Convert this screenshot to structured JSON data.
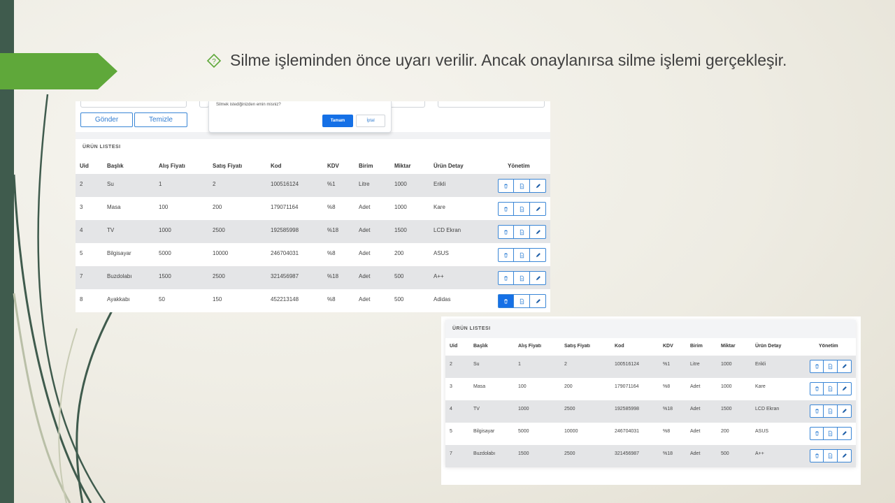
{
  "slide": {
    "bullet_text": "Silme işleminden önce uyarı verilir. Ancak onaylanırsa silme işlemi gerçekleşir."
  },
  "colors": {
    "accent_green": "#5fa83a",
    "dark_strip": "#3f5b4d",
    "primary_blue": "#1570e6",
    "row_gray": "#e4e5e7"
  },
  "form": {
    "send_label": "Gönder",
    "clear_label": "Temizle"
  },
  "dialog": {
    "message": "Silmek istediğinizden emin misniz?",
    "ok_label": "Tamam",
    "cancel_label": "İptal"
  },
  "table": {
    "title": "ÜRÜN LISTESI",
    "columns": [
      "Uid",
      "Başlık",
      "Alış Fiyatı",
      "Satış Fiyatı",
      "Kod",
      "KDV",
      "Birim",
      "Miktar",
      "Ürün Detay",
      "Yönetim"
    ],
    "rows": [
      [
        "2",
        "Su",
        "1",
        "2",
        "100516124",
        "%1",
        "Litre",
        "1000",
        "Erikli"
      ],
      [
        "3",
        "Masa",
        "100",
        "200",
        "179071164",
        "%8",
        "Adet",
        "1000",
        "Kare"
      ],
      [
        "4",
        "TV",
        "1000",
        "2500",
        "192585998",
        "%18",
        "Adet",
        "1500",
        "LCD Ekran"
      ],
      [
        "5",
        "Bilgisayar",
        "5000",
        "10000",
        "246704031",
        "%8",
        "Adet",
        "200",
        "ASUS"
      ],
      [
        "7",
        "Buzdolabı",
        "1500",
        "2500",
        "321456987",
        "%18",
        "Adet",
        "500",
        "A++"
      ],
      [
        "8",
        "Ayakkabı",
        "50",
        "150",
        "452213148",
        "%8",
        "Adet",
        "500",
        "Adidas"
      ]
    ]
  },
  "table2": {
    "title": "ÜRÜN LISTESI",
    "columns": [
      "Uid",
      "Başlık",
      "Alış Fiyatı",
      "Satış Fiyatı",
      "Kod",
      "KDV",
      "Birim",
      "Miktar",
      "Ürün Detay",
      "Yönetim"
    ],
    "rows": [
      [
        "2",
        "Su",
        "1",
        "2",
        "100516124",
        "%1",
        "Litre",
        "1000",
        "Erikli"
      ],
      [
        "3",
        "Masa",
        "100",
        "200",
        "179071164",
        "%8",
        "Adet",
        "1000",
        "Kare"
      ],
      [
        "4",
        "TV",
        "1000",
        "2500",
        "192585998",
        "%18",
        "Adet",
        "1500",
        "LCD Ekran"
      ],
      [
        "5",
        "Bilgisayar",
        "5000",
        "10000",
        "246704031",
        "%8",
        "Adet",
        "200",
        "ASUS"
      ],
      [
        "7",
        "Buzdolabı",
        "1500",
        "2500",
        "321456987",
        "%18",
        "Adet",
        "500",
        "A++"
      ]
    ]
  },
  "icons": {
    "delete": "trash-icon",
    "detail": "document-icon",
    "edit": "pencil-icon",
    "bullet": "diamond-question-icon"
  }
}
